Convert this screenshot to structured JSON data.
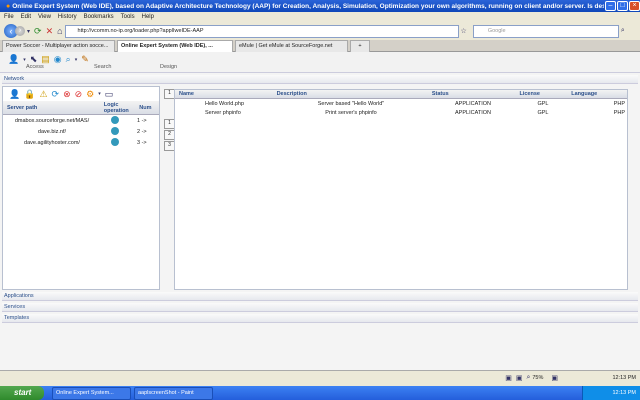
{
  "window": {
    "title": "Online Expert System (Web IDE), based on Adaptive Architecture Technology (AAP) for Creation, Analysis, Simulation, Optimization your own algorithms, running on client and/or server. Is designed to be easily cro..."
  },
  "menu": [
    "File",
    "Edit",
    "View",
    "History",
    "Bookmarks",
    "Tools",
    "Help"
  ],
  "nav": {
    "url": "http://vcomm.no-ip.org/loader.php?applIweIDE-AAP",
    "search_placeholder": "Google"
  },
  "tabs": [
    {
      "label": "Power Soccer - Multiplayer action socce..."
    },
    {
      "label": "Online Expert System (Web IDE), ..."
    },
    {
      "label": "eMule | Get eMule at SourceForge.net"
    }
  ],
  "app_toolbar": {
    "groups": [
      "Access",
      "Search",
      "Design"
    ]
  },
  "sections": {
    "network": "Network",
    "applications": "Applications",
    "services": "Services",
    "templates": "Templates"
  },
  "left_panel": {
    "columns": {
      "server_path": "Server path",
      "logic_operation": "Logic operation",
      "num": "Num"
    },
    "rows": [
      {
        "path": "dmabox.sourceforge.net/MAS/",
        "num": "1 ->"
      },
      {
        "path": "dave.biz.nf/",
        "num": "2 ->"
      },
      {
        "path": "dave.agilityhoster.com/",
        "num": "3 ->"
      }
    ]
  },
  "side_numbers": [
    "1",
    "1",
    "2",
    "3"
  ],
  "right_panel": {
    "columns": {
      "name": "Name",
      "description": "Description",
      "status": "Status",
      "license": "License",
      "language": "Language"
    },
    "rows": [
      {
        "name": "Hello World.php",
        "description": "Server based \"Hello World\"",
        "status": "APPLICATION",
        "license": "GPL",
        "language": "PHP"
      },
      {
        "name": "Server phpinfo",
        "description": "Print server's phpinfo",
        "status": "APPLICATION",
        "license": "GPL",
        "language": "PHP"
      }
    ]
  },
  "statusbar": {
    "zoom": "75%",
    "tray": "12:13 PM"
  },
  "taskbar": {
    "start": "start",
    "items": [
      {
        "label": "Online Expert System..."
      },
      {
        "label": "aaplscreenShot - Paint"
      }
    ],
    "clock": "12:13 PM"
  },
  "colors": {
    "title_blue": "#0f47b8",
    "taskbar_blue": "#245edb",
    "start_green": "#2f8a2c",
    "header_text": "#2b4f8a"
  }
}
